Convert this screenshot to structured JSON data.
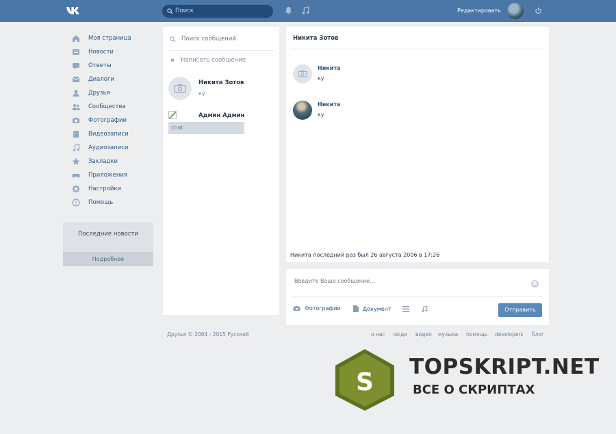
{
  "header": {
    "search_placeholder": "Поиск",
    "user_name": "Редактировать"
  },
  "sidebar": {
    "items": [
      {
        "label": "Моя страница",
        "icon": "home-icon"
      },
      {
        "label": "Новости",
        "icon": "news-icon"
      },
      {
        "label": "Ответы",
        "icon": "feedback-icon"
      },
      {
        "label": "Диалоги",
        "icon": "messages-icon"
      },
      {
        "label": "Друзья",
        "icon": "user-icon"
      },
      {
        "label": "Сообщества",
        "icon": "groups-icon"
      },
      {
        "label": "Фотографии",
        "icon": "camera-icon"
      },
      {
        "label": "Видеозаписи",
        "icon": "film-icon"
      },
      {
        "label": "Аудиозаписи",
        "icon": "music-icon"
      },
      {
        "label": "Закладки",
        "icon": "star-icon"
      },
      {
        "label": "Приложения",
        "icon": "gamepad-icon"
      },
      {
        "label": "Настройки",
        "icon": "gear-icon"
      },
      {
        "label": "Помощь",
        "icon": "help-icon"
      }
    ],
    "news_box": {
      "title": "Последние новости",
      "button": "Подробнее"
    }
  },
  "dialogs": {
    "search_placeholder": "Поиск сообщений",
    "write_label": "Написать сообщение",
    "items": [
      {
        "name": "Никита Зотов",
        "preview": "ку"
      },
      {
        "name": "Админ Админ",
        "preview": "chat"
      }
    ]
  },
  "chat": {
    "title": "Никита Зотов",
    "messages": [
      {
        "author": "Никита",
        "text": "ку"
      },
      {
        "author": "Никита",
        "text": "ку"
      }
    ],
    "last_seen": "Никита последний раз был 26 августа 2006 в 17:26"
  },
  "composer": {
    "placeholder": "Введите Ваше сообщение...",
    "attach_photo": "Фотографии",
    "attach_doc": "Документ",
    "send_label": "Отправить"
  },
  "footer": {
    "copyright": "Друзья © 2004 - 2015  Русский",
    "links": [
      "о нас",
      "люди",
      "видео",
      "музыка",
      "помощь",
      "developers",
      "блог"
    ]
  },
  "watermark": {
    "letter": "S",
    "title": "TOPSKRIPT.NET",
    "subtitle": "ВСЕ О СКРИПТАХ"
  },
  "colors": {
    "header": "#4a76a8",
    "page_bg": "#edeef0",
    "send_button": "#5b88bd",
    "watermark_green": "#7d8f2e"
  }
}
